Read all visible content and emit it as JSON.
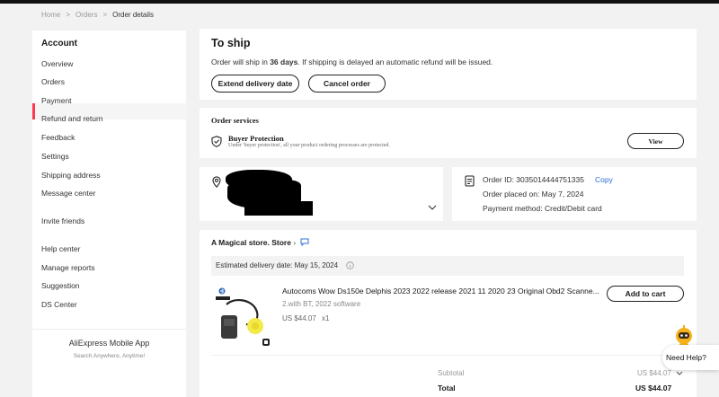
{
  "breadcrumb": {
    "home": "Home",
    "sep": ">",
    "orders": "Orders",
    "current": "Order details"
  },
  "sidebar": {
    "title": "Account",
    "items": [
      "Overview",
      "Orders",
      "Payment",
      "Refund and return",
      "Feedback",
      "Settings",
      "Shipping address",
      "Message center",
      "Invite friends",
      "Help center",
      "Manage reports",
      "Suggestion",
      "DS Center"
    ],
    "app_title": "AliExpress Mobile App",
    "app_subtitle": "Search Anywhere, Anytime!"
  },
  "status": {
    "title": "To ship",
    "message_prefix": "Order will ship in ",
    "days": "36 days",
    "message_suffix": ". If shipping is delayed an automatic refund will be issued.",
    "extend_button": "Extend delivery date",
    "cancel_button": "Cancel order"
  },
  "services": {
    "title": "Order services",
    "protection_title": "Buyer Protection",
    "protection_text": "Under 'buyer protection', all your product ordering processes are protected.",
    "view_button": "View"
  },
  "order_info": {
    "order_id_label": "Order ID: 3035014444751335",
    "copy": "Copy",
    "placed": "Order placed on: May 7, 2024",
    "payment": "Payment method: Credit/Debit card"
  },
  "store": {
    "name": "A Magical store. Store",
    "estimated": "Estimated delivery date: May 15, 2024",
    "product_title": "Autocoms Wow Ds150e Delphis 2023 2022 release 2021 11 2020 23 Original Obd2 Scanne...",
    "product_variant": "2.with BT, 2022 software",
    "price": "US $44.07",
    "qty": "x1",
    "add_to_cart": "Add to cart",
    "subtotal_label": "Subtotal",
    "subtotal_value": "US $44.07",
    "total_label": "Total",
    "total_value": "US $44.07"
  },
  "help": {
    "label": "Need Help?"
  },
  "colors": {
    "accent": "#fd384f",
    "link": "#2e6ed8",
    "text": "#191919"
  }
}
